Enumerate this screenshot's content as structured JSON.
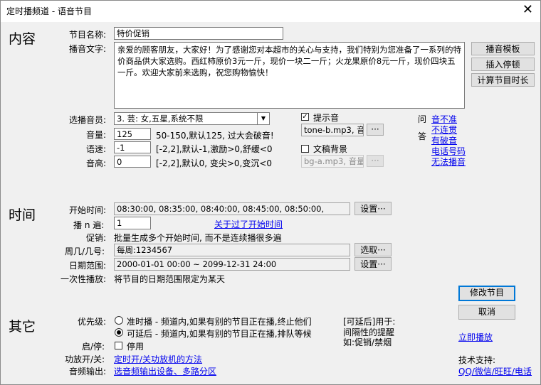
{
  "window": {
    "title": "定时播频道 - 语音节目",
    "close_glyph": "✕"
  },
  "sections": {
    "content": "内容",
    "time": "时间",
    "other": "其它"
  },
  "content": {
    "program_name_label": "节目名称:",
    "program_name_value": "特价促销",
    "broadcast_text_label": "播音文字:",
    "broadcast_text_value": "亲爱的顾客朋友，大家好！为了感谢您对本超市的关心与支持，我们特别为您准备了一系列的特价商品供大家选购。西红柿原价3元一斤，现价一块二一斤；火龙果原价8元一斤，现价四块五一斤。欢迎大家前来选购，祝您购物愉快！",
    "btn_template": "播音模板",
    "btn_insert_pause": "插入停顿",
    "btn_calc_length": "计算节目时长",
    "voice_label": "选播音员:",
    "voice_value": "3. 芸: 女,五星,系统不限",
    "volume_label": "音量:",
    "volume_value": "125",
    "volume_hint": "50-150,默认125, 过大会破音!",
    "speed_label": "语速:",
    "speed_value": "-1",
    "speed_hint": "[-2,2],默认-1,激励>0,舒缓<0",
    "pitch_label": "音高:",
    "pitch_value": "0",
    "pitch_hint": "[-2,2],默认0, 变尖>0,变沉<0",
    "prompt_sound_label": "提示音",
    "prompt_sound_file": "tone-b.mp3, 音",
    "prompt_sound_btn": "···",
    "bg_label": "文稿背景",
    "bg_file": "bg-a.mp3, 音量",
    "bg_btn": "···",
    "qa_q": "问",
    "qa_a": "答",
    "qa_links": [
      "音不准",
      "不连贯",
      "有破音",
      "电话号码",
      "无法播音"
    ]
  },
  "time": {
    "start_label": "开始时间:",
    "start_value": "08:30:00,   08:35:00,   08:40:00,   08:45:00,   08:50:00,",
    "start_btn": "设置···",
    "repeat_label": "播 n 遍:",
    "repeat_value": "1",
    "past_link": "关于过了开始时间",
    "promo_label": "促销:",
    "promo_text": "批量生成多个开始时间, 而不是连续播很多遍",
    "week_label": "周几/几号:",
    "week_value": "每周:1234567",
    "week_btn": "选取···",
    "date_label": "日期范围:",
    "date_value": "2000-01-01 00:00 ~ 2099-12-31 24:00",
    "date_btn": "设置···",
    "once_label": "一次性播放:",
    "once_text": "将节目的日期范围限定为某天"
  },
  "actions": {
    "modify": "修改节目",
    "cancel": "取消",
    "play_now": "立即播放"
  },
  "other": {
    "priority_label": "优先级:",
    "priority_option1": "准时播 - 频道内,如果有别的节目正在播,终止他们",
    "priority_option2": "可延后 - 频道内,如果有别的节目正在播,排队等候",
    "delay_note": [
      "[可延后]用于:",
      "间隔性的提醒",
      "如:促销/禁烟"
    ],
    "enable_label": "启/停:",
    "disable_checkbox": "停用",
    "amp_label": "功放开/关:",
    "amp_link": "定时开/关功放机的方法",
    "audio_label": "音频输出:",
    "audio_link": "选音频输出设备、多路分区",
    "support_label": "技术支持:",
    "support_link": "QQ/微信/旺旺/电话"
  }
}
